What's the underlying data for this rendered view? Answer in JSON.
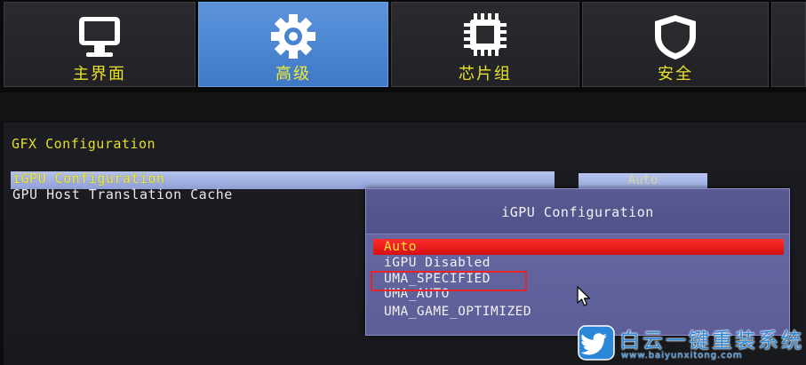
{
  "tabs": [
    {
      "label": "主界面",
      "icon": "monitor-icon",
      "active": false
    },
    {
      "label": "高级",
      "icon": "gear-icon",
      "active": true
    },
    {
      "label": "芯片组",
      "icon": "chip-icon",
      "active": false
    },
    {
      "label": "安全",
      "icon": "shield-icon",
      "active": false
    }
  ],
  "section": {
    "title": "GFX Configuration"
  },
  "options": [
    {
      "label": "iGPU Configuration",
      "value": "Auto",
      "selected": true
    },
    {
      "label": "GPU Host Translation Cache",
      "selected": false
    }
  ],
  "popup": {
    "title": "iGPU Configuration",
    "items": [
      {
        "label": "Auto",
        "highlighted": true
      },
      {
        "label": "iGPU Disabled",
        "highlighted": false
      },
      {
        "label": "UMA_SPECIFIED",
        "highlighted": false,
        "annotated": true
      },
      {
        "label": "UMA_AUTO",
        "highlighted": false
      },
      {
        "label": "UMA_GAME_OPTIMIZED",
        "highlighted": false
      }
    ]
  },
  "watermark": {
    "title": "白云一键重装系统",
    "url": "www.baiyunxitong.com",
    "icon": "twitter-bird-icon"
  },
  "colors": {
    "accent_yellow": "#e8e32a",
    "active_tab_blue": "#4f88d4",
    "popup_purple": "#6363a0",
    "highlight_red": "#e81c1c",
    "annotation_red": "#e3262b",
    "watermark_blue": "#2c87d8"
  }
}
